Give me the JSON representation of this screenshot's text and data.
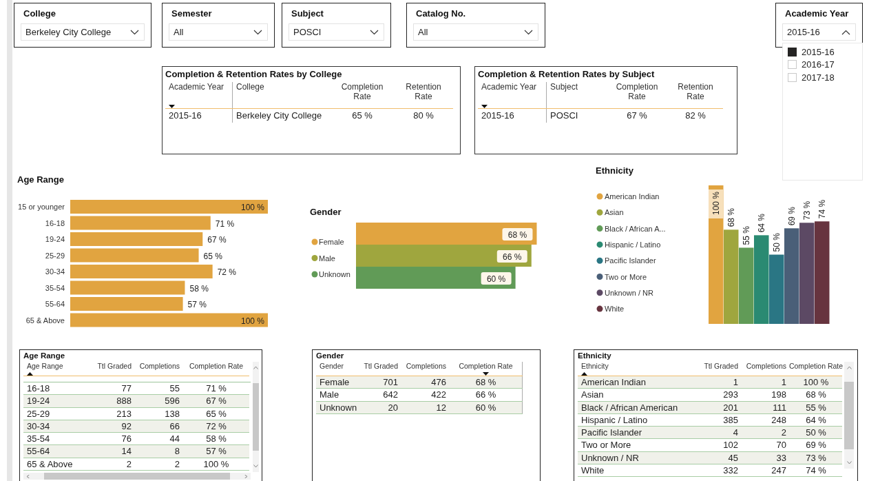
{
  "slicers": [
    {
      "title": "College",
      "value": "Berkeley City College",
      "expanded": false
    },
    {
      "title": "Semester",
      "value": "All",
      "expanded": false
    },
    {
      "title": "Subject",
      "value": "POSCI",
      "expanded": false
    },
    {
      "title": "Catalog No.",
      "value": "All",
      "expanded": false
    },
    {
      "title": "Academic Year",
      "value": "2015-16",
      "expanded": true,
      "options": [
        {
          "label": "2015-16",
          "checked": true
        },
        {
          "label": "2016-17",
          "checked": false
        },
        {
          "label": "2017-18",
          "checked": false
        }
      ]
    }
  ],
  "summary_tables": [
    {
      "title": "Completion & Retention Rates by College",
      "columns": [
        {
          "label": "Academic Year",
          "sorted": true,
          "descending": true
        },
        {
          "label": "College",
          "sorted": false
        },
        {
          "label": "Completion Rate",
          "sorted": false
        },
        {
          "label": "Retention Rate",
          "sorted": false
        }
      ],
      "rows": [
        [
          "2015-16",
          "Berkeley City College",
          "65 %",
          "80 %"
        ]
      ]
    },
    {
      "title": "Completion & Retention Rates by Subject",
      "columns": [
        {
          "label": "Academic Year",
          "sorted": true,
          "descending": true
        },
        {
          "label": "Subject",
          "sorted": false
        },
        {
          "label": "Completion Rate",
          "sorted": false
        },
        {
          "label": "Retention Rate",
          "sorted": false
        }
      ],
      "rows": [
        [
          "2015-16",
          "POSCI",
          "67 %",
          "82 %"
        ]
      ]
    }
  ],
  "age_chart": {
    "title": "Age Range",
    "chart_data": {
      "type": "bar",
      "orientation": "horizontal",
      "categories": [
        "15 or younger",
        "16-18",
        "19-24",
        "25-29",
        "30-34",
        "35-54",
        "55-64",
        "65 & Above"
      ],
      "values": [
        100,
        71,
        67,
        65,
        72,
        58,
        57,
        100
      ],
      "value_labels": [
        "100 %",
        "71 %",
        "67 %",
        "65 %",
        "72 %",
        "58 %",
        "57 %",
        "100 %"
      ]
    }
  },
  "gender_chart": {
    "title": "Gender",
    "chart_data": {
      "type": "bar",
      "orientation": "horizontal",
      "legend": "left",
      "series": [
        {
          "name": "Female",
          "color": "#e1a440",
          "values": [
            68
          ],
          "value_labels": [
            "68 %"
          ]
        },
        {
          "name": "Male",
          "color": "#9fa63e",
          "values": [
            66
          ],
          "value_labels": [
            "66 %"
          ]
        },
        {
          "name": "Unknown",
          "color": "#619b57",
          "values": [
            60
          ],
          "value_labels": [
            "60 %"
          ]
        }
      ]
    }
  },
  "ethnicity_chart": {
    "title": "Ethnicity",
    "chart_data": {
      "type": "bar",
      "orientation": "vertical",
      "legend": "left",
      "series": [
        {
          "name": "American Indian",
          "color": "#e1a440",
          "values": [
            100
          ],
          "value_labels": [
            "100 %"
          ]
        },
        {
          "name": "Asian",
          "color": "#9fa63e",
          "values": [
            68
          ],
          "value_labels": [
            "68 %"
          ]
        },
        {
          "name": "Black / African A...",
          "color": "#619b57",
          "values": [
            55
          ],
          "value_labels": [
            "55 %"
          ]
        },
        {
          "name": "Hispanic / Latino",
          "color": "#2a8a72",
          "values": [
            64
          ],
          "value_labels": [
            "64 %"
          ]
        },
        {
          "name": "Pacific Islander",
          "color": "#2a7684",
          "values": [
            50
          ],
          "value_labels": [
            "50 %"
          ]
        },
        {
          "name": "Two or More",
          "color": "#4a5f78",
          "values": [
            69
          ],
          "value_labels": [
            "69 %"
          ]
        },
        {
          "name": "Unknown / NR",
          "color": "#5c4964",
          "values": [
            73
          ],
          "value_labels": [
            "73 %"
          ]
        },
        {
          "name": "White",
          "color": "#67343f",
          "values": [
            74
          ],
          "value_labels": [
            "74 %"
          ]
        }
      ]
    }
  },
  "detail_tables": [
    {
      "title": "Age Range",
      "columns": [
        {
          "label": "Age Range",
          "sorted": true,
          "descending": false
        },
        {
          "label": "Ttl Graded",
          "sorted": false
        },
        {
          "label": "Completions",
          "sorted": false
        },
        {
          "label": "Completion Rate",
          "sorted": false
        }
      ],
      "rows": [
        [
          "16-18",
          "77",
          "55",
          "71 %"
        ],
        [
          "19-24",
          "888",
          "596",
          "67 %"
        ],
        [
          "25-29",
          "213",
          "138",
          "65 %"
        ],
        [
          "30-34",
          "92",
          "66",
          "72 %"
        ],
        [
          "35-54",
          "76",
          "44",
          "58 %"
        ],
        [
          "55-64",
          "14",
          "8",
          "57 %"
        ],
        [
          "65 & Above",
          "2",
          "2",
          "100 %"
        ]
      ]
    },
    {
      "title": "Gender",
      "columns": [
        {
          "label": "Gender",
          "sorted": false
        },
        {
          "label": "Ttl Graded",
          "sorted": false
        },
        {
          "label": "Completions",
          "sorted": false
        },
        {
          "label": "Completion Rate",
          "sorted": true,
          "descending": true
        }
      ],
      "rows": [
        [
          "Female",
          "701",
          "476",
          "68 %"
        ],
        [
          "Male",
          "642",
          "422",
          "66 %"
        ],
        [
          "Unknown",
          "20",
          "12",
          "60 %"
        ]
      ]
    },
    {
      "title": "Ethnicity",
      "columns": [
        {
          "label": "Ethnicity",
          "sorted": true,
          "descending": false
        },
        {
          "label": "Ttl Graded",
          "sorted": false
        },
        {
          "label": "Completions",
          "sorted": false
        },
        {
          "label": "Completion Rate",
          "sorted": false
        }
      ],
      "rows": [
        [
          "American Indian",
          "1",
          "1",
          "100 %"
        ],
        [
          "Asian",
          "293",
          "198",
          "68 %"
        ],
        [
          "Black / African American",
          "201",
          "111",
          "55 %"
        ],
        [
          "Hispanic / Latino",
          "385",
          "248",
          "64 %"
        ],
        [
          "Pacific Islander",
          "4",
          "2",
          "50 %"
        ],
        [
          "Two or More",
          "102",
          "70",
          "69 %"
        ],
        [
          "Unknown / NR",
          "45",
          "33",
          "73 %"
        ],
        [
          "White",
          "332",
          "247",
          "74 %"
        ]
      ]
    }
  ]
}
